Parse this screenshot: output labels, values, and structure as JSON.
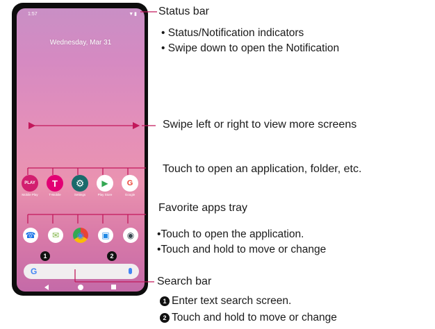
{
  "phone": {
    "status_time": "1:57",
    "status_icons": "▼▮",
    "date": "Wednesday, Mar 31",
    "apps": [
      {
        "name": "Mobile Play",
        "glyph": "PLAY",
        "color": "#d21e6f"
      },
      {
        "name": "T-Mobile",
        "glyph": "T",
        "color": "#e20074"
      },
      {
        "name": "Settings",
        "glyph": "⚙",
        "color": "#1a6a6b"
      },
      {
        "name": "Play Store",
        "glyph": "▶",
        "color": "#ffffff"
      },
      {
        "name": "Google",
        "glyph": "G",
        "color": "#ffffff"
      }
    ],
    "dock": [
      {
        "name": "phone",
        "glyph": "☎",
        "color": "#1a73e8"
      },
      {
        "name": "messages",
        "glyph": "✉",
        "color": "#7cb342"
      },
      {
        "name": "chrome",
        "glyph": "◉",
        "color": "#e53935"
      },
      {
        "name": "contacts",
        "glyph": "▣",
        "color": "#1e88e5"
      },
      {
        "name": "camera",
        "glyph": "◉",
        "color": "#37474f"
      }
    ],
    "search_g": "G",
    "badge1": "1",
    "badge2": "2"
  },
  "callouts": {
    "status_bar": "Status bar",
    "status_points": [
      "• Status/Notification indicators",
      "• Swipe down to open the Notification"
    ],
    "swipe": "Swipe left or right to view more screens",
    "touch_app": "Touch to open an application, folder, etc.",
    "favorite": "Favorite apps tray",
    "favorite_points": [
      "•Touch to open the application.",
      "•Touch and hold to move or change"
    ],
    "search_bar": "Search bar",
    "search_points": [
      "Enter text search screen.",
      "Touch and hold to move or change"
    ],
    "search_badges": [
      "1",
      "2"
    ]
  },
  "colors": {
    "line": "#c2185b",
    "arrow": "#c2185b"
  }
}
